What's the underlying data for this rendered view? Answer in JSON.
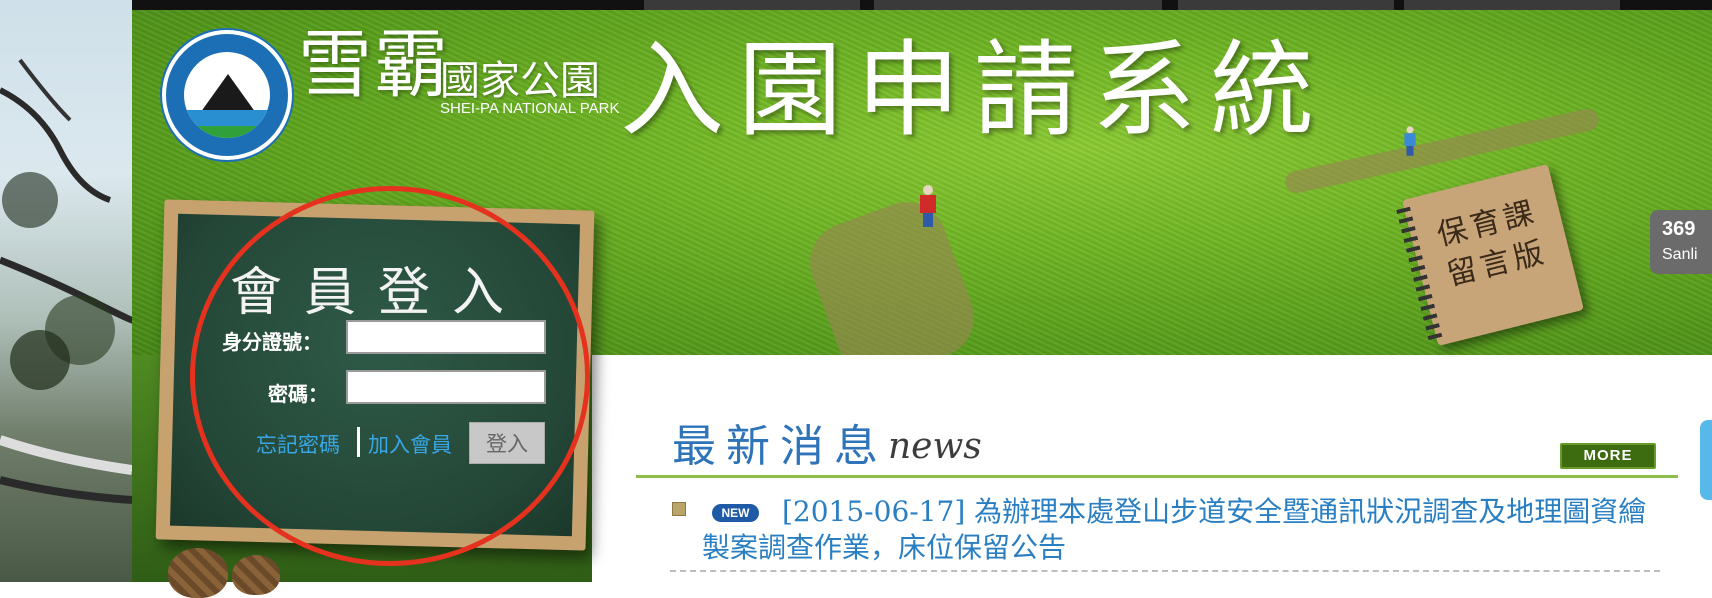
{
  "banner": {
    "park_name_large": "雪霸",
    "park_name_small": "國家公園",
    "park_name_en": "SHEI-PA NATIONAL PARK",
    "system_title": "入園申請系統",
    "notebook_line1": "保育課",
    "notebook_line2": "留言版",
    "sign_distance": "369",
    "sign_place": "Sanli"
  },
  "login": {
    "title": "會員登入",
    "id_label": "身分證號：",
    "password_label": "密碼：",
    "id_value": "",
    "password_value": "",
    "forgot_password": "忘記密碼",
    "join_member": "加入會員",
    "login_button": "登入"
  },
  "news": {
    "title": "最新消息",
    "subtitle": "news",
    "more_button": "MORE",
    "items": [
      {
        "badge": "NEW",
        "text": "[2015-06-17] 為辦理本處登山步道安全暨通訊狀況調查及地理圖資繪製案調查作業，床位保留公告"
      }
    ]
  },
  "colors": {
    "annotation": "#e5321e",
    "link": "#38a7e6",
    "news_title": "#2f73b8",
    "news_rule": "#8ebd4a"
  }
}
